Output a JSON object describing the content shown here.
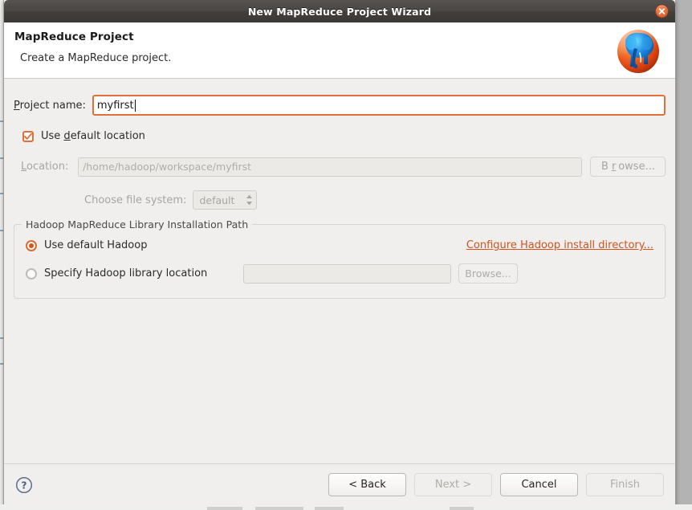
{
  "window": {
    "title": "New MapReduce Project Wizard",
    "close_icon": "close-icon"
  },
  "header": {
    "title": "MapReduce Project",
    "subtitle": "Create a MapReduce project.",
    "logo_icon": "hadoop-elephant-logo"
  },
  "form": {
    "project_name_label_pre": "P",
    "project_name_label_post": "roject name:",
    "project_name_value": "myfirst",
    "use_default_location": {
      "checked": true,
      "label_pre": "Use ",
      "label_mnemonic": "d",
      "label_post": "efault location"
    },
    "location": {
      "label_pre": "L",
      "label_post": "ocation:",
      "value": "/home/hadoop/workspace/myfirst",
      "enabled": false,
      "browse_label_pre": "B",
      "browse_label_mnemonic": "r",
      "browse_label_post": "owse..."
    },
    "file_system": {
      "label": "Choose file system:",
      "selected": "default",
      "enabled": false
    }
  },
  "library_group": {
    "title": "Hadoop MapReduce Library Installation Path",
    "option_default": {
      "label": "Use default Hadoop",
      "selected": true
    },
    "option_specify": {
      "label": "Specify Hadoop library location",
      "selected": false,
      "path_value": "",
      "browse_label": "Browse..."
    },
    "configure_link": "Configure Hadoop install directory..."
  },
  "footer": {
    "help_icon": "help-icon",
    "back_label": "< Back",
    "next_label": "Next >",
    "cancel_label": "Cancel",
    "finish_label": "Finish",
    "back_enabled": true,
    "next_enabled": false,
    "cancel_enabled": true,
    "finish_enabled": false
  },
  "colors": {
    "accent_orange": "#e0703a",
    "link_orange": "#d4521c",
    "titlebar_dark": "#4a4744",
    "dialog_bg": "#f0efee",
    "desktop_gray": "#b3b3b3"
  }
}
